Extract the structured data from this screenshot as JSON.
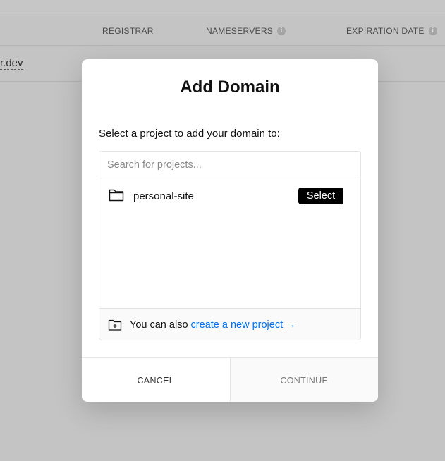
{
  "background": {
    "columns": [
      {
        "label": "REGISTRAR",
        "info": false
      },
      {
        "label": "NAMESERVERS",
        "info": true
      },
      {
        "label": "EXPIRATION DATE",
        "info": true
      }
    ],
    "row_domain_fragment": "r.dev",
    "info_glyph": "i"
  },
  "modal": {
    "title": "Add Domain",
    "subtitle": "Select a project to add your domain to:",
    "search": {
      "placeholder": "Search for projects...",
      "value": ""
    },
    "projects": [
      {
        "name": "personal-site",
        "icon": "folder-icon",
        "action_label": "Select"
      }
    ],
    "footer": {
      "prefix": "You can also ",
      "link_label": "create a new project →",
      "icon": "folder-plus-icon"
    },
    "actions": {
      "cancel_label": "CANCEL",
      "continue_label": "CONTINUE"
    }
  }
}
